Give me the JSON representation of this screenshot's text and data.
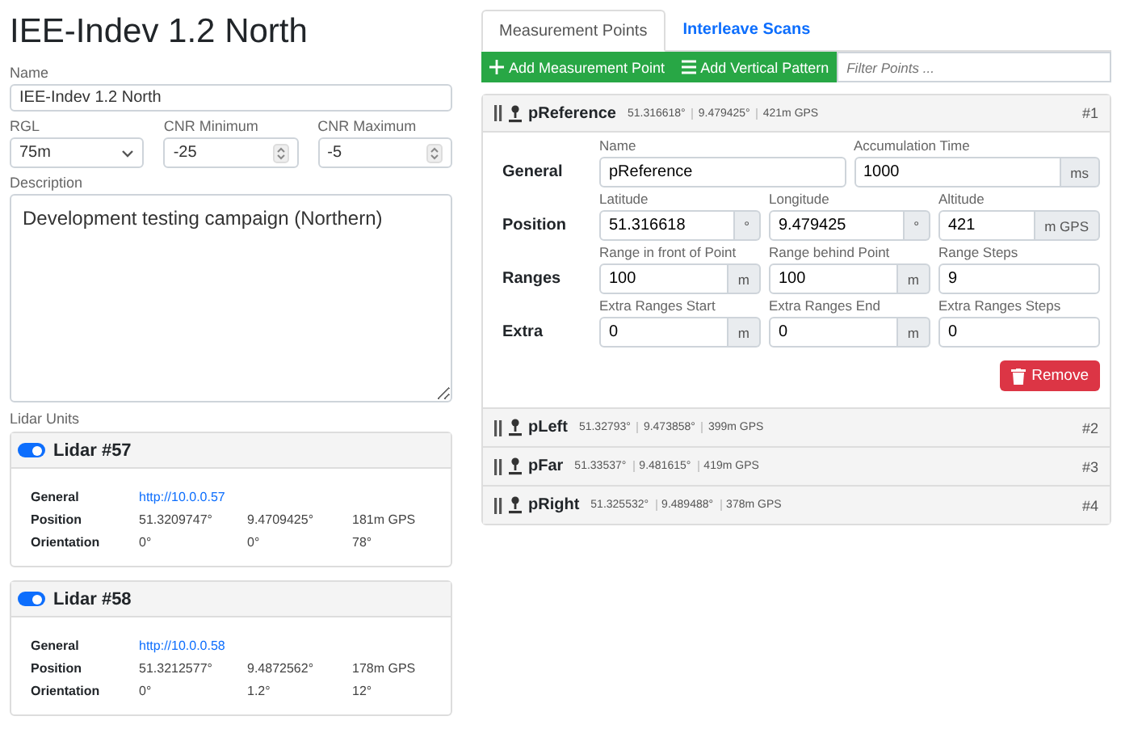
{
  "title": "IEE-Indev 1.2 North",
  "form": {
    "name": {
      "label": "Name",
      "value": "IEE-Indev 1.2 North"
    },
    "rgl": {
      "label": "RGL",
      "value": "75m"
    },
    "cnr_min": {
      "label": "CNR Minimum",
      "value": "-25"
    },
    "cnr_max": {
      "label": "CNR Maximum",
      "value": "-5"
    },
    "description": {
      "label": "Description",
      "value": "Development testing campaign (Northern)"
    }
  },
  "lidar_units": {
    "label": "Lidar Units",
    "units": [
      {
        "name": "Lidar #57",
        "enabled": true,
        "rows": [
          {
            "label": "General",
            "kind": "link",
            "values": [
              "http://10.0.0.57"
            ]
          },
          {
            "label": "Position",
            "kind": "values",
            "values": [
              "51.3209747°",
              "9.4709425°",
              "181m GPS"
            ]
          },
          {
            "label": "Orientation",
            "kind": "values",
            "values": [
              "0°",
              "0°",
              "78°"
            ]
          }
        ]
      },
      {
        "name": "Lidar #58",
        "enabled": true,
        "rows": [
          {
            "label": "General",
            "kind": "link",
            "values": [
              "http://10.0.0.58"
            ]
          },
          {
            "label": "Position",
            "kind": "values",
            "values": [
              "51.3212577°",
              "9.4872562°",
              "178m GPS"
            ]
          },
          {
            "label": "Orientation",
            "kind": "values",
            "values": [
              "0°",
              "1.2°",
              "12°"
            ]
          }
        ]
      }
    ]
  },
  "tabs": [
    {
      "label": "Measurement Points",
      "selected": true
    },
    {
      "label": "Interleave Scans",
      "selected": false
    }
  ],
  "toolbar": {
    "buttons": [
      {
        "label": "Add Measurement Point",
        "kind": "add"
      },
      {
        "label": "Add Vertical Pattern",
        "kind": "pattern"
      }
    ],
    "filter": {
      "placeholder": "Filter Points ..."
    }
  },
  "points": [
    {
      "name": "pReference",
      "lat": "51.316618°",
      "lon": "9.479425°",
      "alt": "421m GPS",
      "index": "#1",
      "expanded": true,
      "groups": [
        {
          "label": "General",
          "fields": [
            {
              "label": "Name",
              "value": "pReference"
            },
            {
              "label": "Accumulation Time",
              "value": "1000",
              "unit": "ms"
            }
          ]
        },
        {
          "label": "Position",
          "fields": [
            {
              "label": "Latitude",
              "value": "51.316618",
              "unit": "°"
            },
            {
              "label": "Longitude",
              "value": "9.479425",
              "unit": "°"
            },
            {
              "label": "Altitude",
              "value": "421",
              "unit": "m GPS"
            }
          ]
        },
        {
          "label": "Ranges",
          "fields": [
            {
              "label": "Range in front of Point",
              "value": "100",
              "unit": "m"
            },
            {
              "label": "Range behind Point",
              "value": "100",
              "unit": "m"
            },
            {
              "label": "Range Steps",
              "value": "9"
            }
          ]
        },
        {
          "label": "Extra",
          "fields": [
            {
              "label": "Extra Ranges Start",
              "value": "0",
              "unit": "m"
            },
            {
              "label": "Extra Ranges End",
              "value": "0",
              "unit": "m"
            },
            {
              "label": "Extra Ranges Steps",
              "value": "0"
            }
          ]
        }
      ],
      "remove": "Remove"
    },
    {
      "name": "pLeft",
      "lat": "51.32793°",
      "lon": "9.473858°",
      "alt": "399m GPS",
      "index": "#2",
      "expanded": false
    },
    {
      "name": "pFar",
      "lat": "51.33537°",
      "lon": "9.481615°",
      "alt": "419m GPS",
      "index": "#3",
      "expanded": false
    },
    {
      "name": "pRight",
      "lat": "51.325532°",
      "lon": "9.489488°",
      "alt": "378m GPS",
      "index": "#4",
      "expanded": false
    }
  ]
}
